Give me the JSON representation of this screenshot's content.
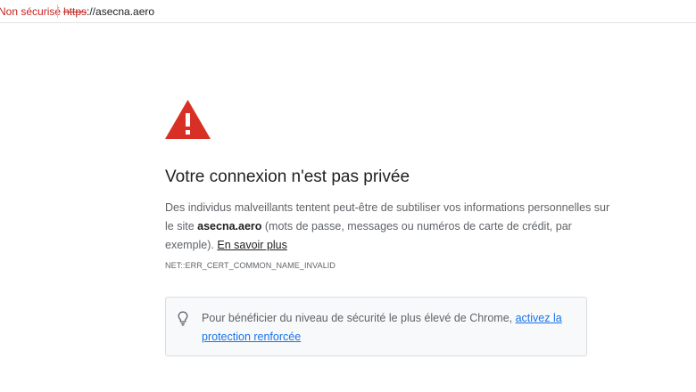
{
  "address_bar": {
    "security_label": "Non sécurisé",
    "url_scheme": "https",
    "url_rest": "://asecna.aero"
  },
  "colors": {
    "danger": "#d93025",
    "link": "#1a73e8",
    "text": "#202124",
    "muted": "#5f6368"
  },
  "icons": {
    "warning": "warning-triangle-icon",
    "tip": "lightbulb-icon"
  },
  "main": {
    "heading": "Votre connexion n'est pas privée",
    "description": {
      "line1": "Des individus malveillants tentent peut-être de subtiliser vos informations personnelles sur",
      "line2_prefix": "le site ",
      "site": "asecna.aero",
      "line2_suffix": " (mots de passe, messages ou numéros de carte de crédit, par",
      "line3_prefix": "exemple). ",
      "learn_more": "En savoir plus"
    },
    "error_code": "NET::ERR_CERT_COMMON_NAME_INVALID"
  },
  "tip": {
    "text": "Pour bénéficier du niveau de sécurité le plus élevé de Chrome, ",
    "link_part1": "activez la",
    "link_part2": "protection renforcée"
  }
}
